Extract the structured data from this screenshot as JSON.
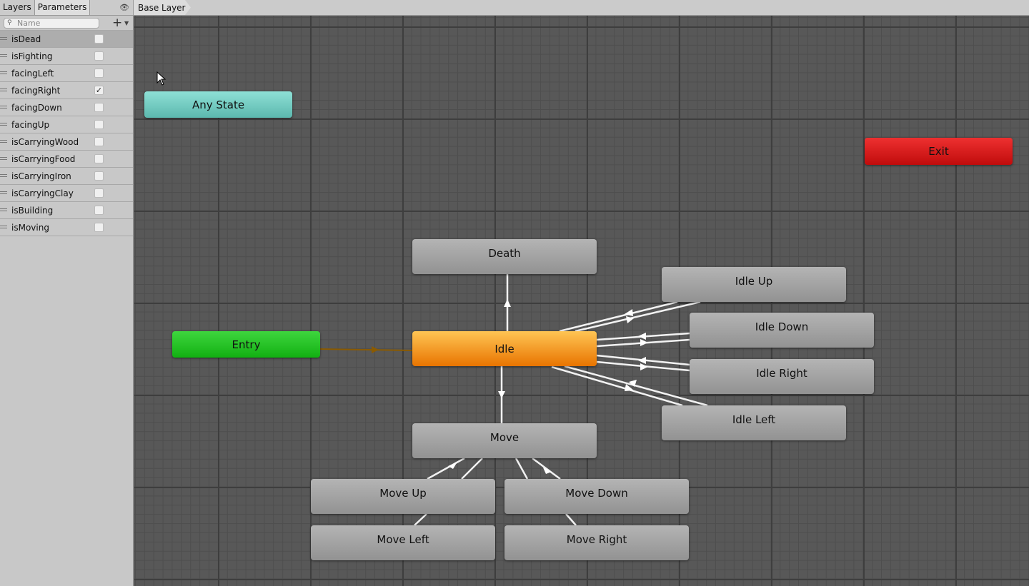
{
  "left_panel": {
    "tabs": [
      {
        "label": "Layers",
        "active": false
      },
      {
        "label": "Parameters",
        "active": true
      }
    ],
    "eye_icon": "eye-icon",
    "search_placeholder": "Name",
    "add_icon": "plus-icon",
    "parameters": [
      {
        "name": "isDead",
        "value": false,
        "selected": true
      },
      {
        "name": "isFighting",
        "value": false
      },
      {
        "name": "facingLeft",
        "value": false
      },
      {
        "name": "facingRight",
        "value": true
      },
      {
        "name": "facingDown",
        "value": false
      },
      {
        "name": "facingUp",
        "value": false
      },
      {
        "name": "isCarryingWood",
        "value": false
      },
      {
        "name": "isCarryingFood",
        "value": false
      },
      {
        "name": "isCarryingIron",
        "value": false
      },
      {
        "name": "isCarryingClay",
        "value": false
      },
      {
        "name": "isBuilding",
        "value": false
      },
      {
        "name": "isMoving",
        "value": false
      }
    ]
  },
  "breadcrumb": "Base Layer",
  "states": {
    "any_state": "Any State",
    "exit": "Exit",
    "entry": "Entry",
    "idle": "Idle",
    "death": "Death",
    "idle_up": "Idle Up",
    "idle_down": "Idle Down",
    "idle_right": "Idle Right",
    "idle_left": "Idle Left",
    "move": "Move",
    "move_up": "Move Up",
    "move_down": "Move Down",
    "move_left": "Move Left",
    "move_right": "Move Right"
  },
  "colors": {
    "any_state": "#6fcfc4",
    "exit": "#e01e1e",
    "entry": "#22c322",
    "default_state": "#e88a10",
    "state": "#a3a3a3",
    "transition": "#ffffff",
    "entry_transition": "#8a5a00"
  }
}
